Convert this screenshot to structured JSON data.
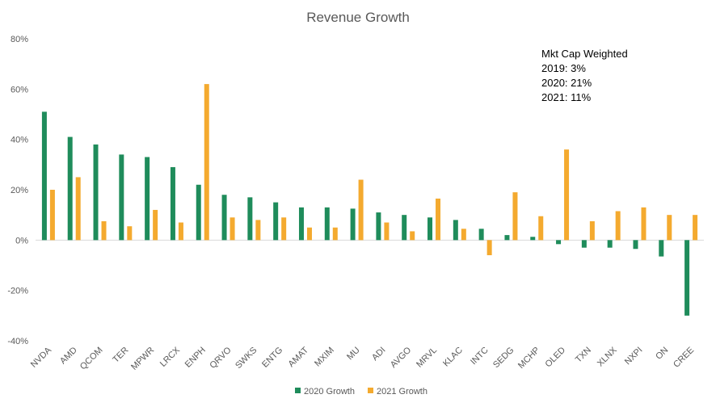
{
  "chart_data": {
    "type": "bar",
    "title": "Revenue Growth",
    "xlabel": "",
    "ylabel": "",
    "ylim": [
      -40,
      80
    ],
    "yticks": [
      -40,
      -20,
      0,
      20,
      40,
      60,
      80
    ],
    "ytick_labels": [
      "-40%",
      "-20%",
      "0%",
      "20%",
      "40%",
      "60%",
      "80%"
    ],
    "grid": false,
    "legend_position": "bottom",
    "categories": [
      "NVDA",
      "AMD",
      "QCOM",
      "TER",
      "MPWR",
      "LRCX",
      "ENPH",
      "QRVO",
      "SWKS",
      "ENTG",
      "AMAT",
      "MXIM",
      "MU",
      "ADI",
      "AVGO",
      "MRVL",
      "KLAC",
      "INTC",
      "SEDG",
      "MCHP",
      "OLED",
      "TXN",
      "XLNX",
      "NXPI",
      "ON",
      "CREE"
    ],
    "series": [
      {
        "name": "2020 Growth",
        "color": "#1F8C5B",
        "values": [
          51,
          41,
          38,
          34,
          33,
          29,
          22,
          18,
          17,
          15,
          13,
          13,
          12.5,
          11,
          10,
          9,
          8,
          4.5,
          2,
          1.3,
          -1.6,
          -3,
          -3,
          -3.5,
          -6.5,
          -30
        ]
      },
      {
        "name": "2021 Growth",
        "color": "#F4AA2F",
        "values": [
          20,
          25,
          7.5,
          5.5,
          12,
          7,
          62,
          9,
          8,
          9,
          5,
          5,
          24,
          7,
          3.5,
          16.5,
          4.5,
          -6,
          19,
          9.5,
          36,
          7.5,
          11.5,
          13,
          10,
          10
        ]
      }
    ],
    "annotation": {
      "title": "Mkt Cap Weighted",
      "lines": [
        "2019: 3%",
        "2020: 21%",
        "2021: 11%"
      ]
    }
  }
}
